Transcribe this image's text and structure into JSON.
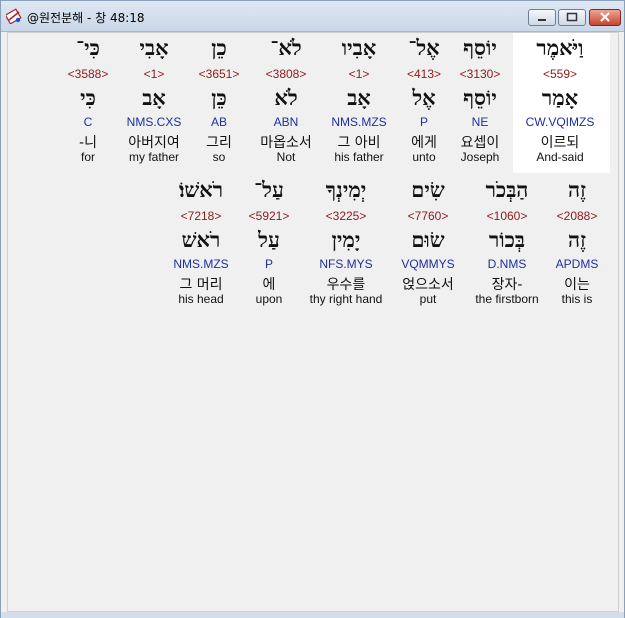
{
  "window": {
    "title": "@원전분해 - 창 48:18",
    "app_icon": "bible-tool-icon",
    "minimize_icon": "minimize-icon",
    "maximize_icon": "maximize-icon",
    "close_icon": "close-icon",
    "close_color": "#c4462f"
  },
  "colors": {
    "strong": "#8b1a1a",
    "parse": "#1c2fa3",
    "highlight": "#ffffff"
  },
  "rows": [
    {
      "words": [
        {
          "heb": "וַיֹּאמֶר",
          "strong": "<559>",
          "lemma": "אָמַר",
          "parse": "CW.VQIMZS",
          "kor": "이르되",
          "eng": "And-said",
          "highlighted": true
        },
        {
          "heb": "יוֹסֵף",
          "strong": "<3130>",
          "lemma": "יוֹסֵף",
          "parse": "NE",
          "kor": "요셉이",
          "eng": "Joseph"
        },
        {
          "heb": "אֶל־",
          "strong": "<413>",
          "lemma": "אֶל",
          "parse": "P",
          "kor": "에게",
          "eng": "unto"
        },
        {
          "heb": "אָבִיו",
          "strong": "<1>",
          "lemma": "אָב",
          "parse": "NMS.MZS",
          "kor": "그 아비",
          "eng": "his father"
        },
        {
          "heb": "לֹא־",
          "strong": "<3808>",
          "lemma": "לֹא",
          "parse": "ABN",
          "kor": "마옵소서",
          "eng": "Not"
        },
        {
          "heb": "כֵן",
          "strong": "<3651>",
          "lemma": "כֵּן",
          "parse": "AB",
          "kor": "그리",
          "eng": "so"
        },
        {
          "heb": "אָבִי",
          "strong": "<1>",
          "lemma": "אָב",
          "parse": "NMS.CXS",
          "kor": "아버지여",
          "eng": "my father"
        },
        {
          "heb": "כִּי־",
          "strong": "<3588>",
          "lemma": "כִּי",
          "parse": "C",
          "kor": "-니",
          "eng": "for"
        }
      ]
    },
    {
      "words": [
        {
          "heb": "זֶה",
          "strong": "<2088>",
          "lemma": "זֶה",
          "parse": "APDMS",
          "kor": "이는",
          "eng": "this is"
        },
        {
          "heb": "הַבְּכֹר",
          "strong": "<1060>",
          "lemma": "בְּכוֹר",
          "parse": "D.NMS",
          "kor": "장자-",
          "eng": "the firstborn"
        },
        {
          "heb": "שִׂים",
          "strong": "<7760>",
          "lemma": "שׂוּם",
          "parse": "VQMMYS",
          "kor": "얹으소서",
          "eng": "put"
        },
        {
          "heb": "יְמִינְךָ",
          "strong": "<3225>",
          "lemma": "יָמִין",
          "parse": "NFS.MYS",
          "kor": "우수를",
          "eng": "thy right hand"
        },
        {
          "heb": "עַל־",
          "strong": "<5921>",
          "lemma": "עַל",
          "parse": "P",
          "kor": "에",
          "eng": "upon"
        },
        {
          "heb": "רֹאשׁוֹ׃",
          "strong": "<7218>",
          "lemma": "רֹאשׁ",
          "parse": "NMS.MZS",
          "kor": "그 머리",
          "eng": "his head"
        }
      ]
    }
  ]
}
